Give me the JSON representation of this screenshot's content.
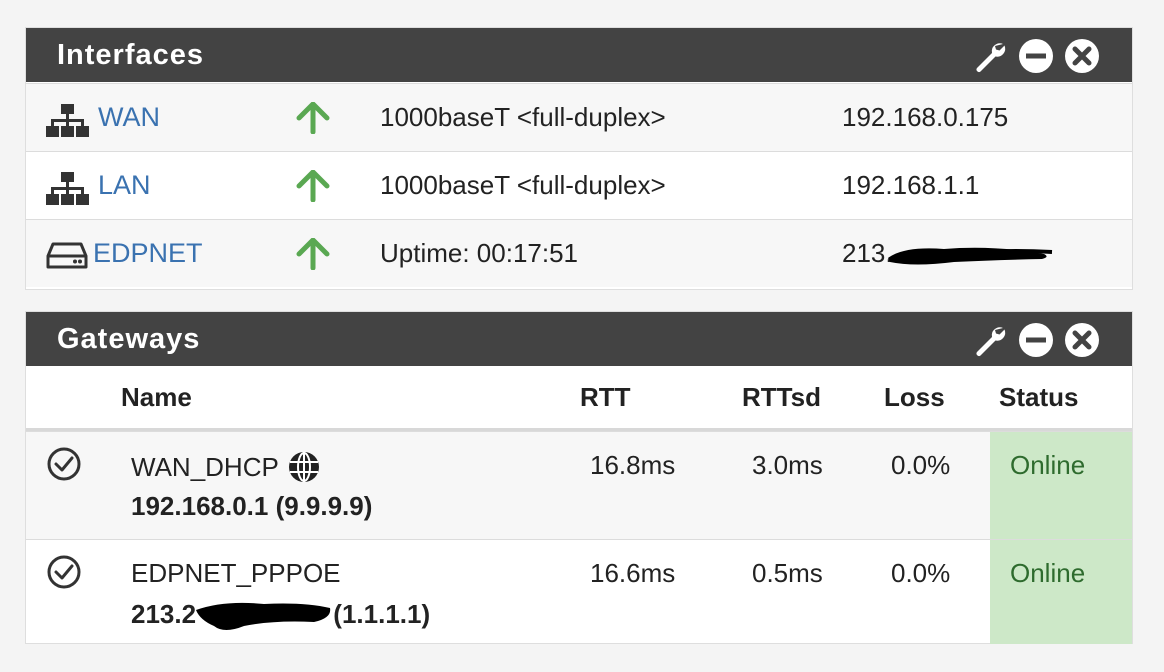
{
  "interfaces": {
    "title": "Interfaces",
    "rows": [
      {
        "name": "WAN",
        "icon": "network-icon",
        "status": "up",
        "media": "1000baseT <full-duplex>",
        "ip": "192.168.0.175"
      },
      {
        "name": "LAN",
        "icon": "network-icon",
        "status": "up",
        "media": "1000baseT <full-duplex>",
        "ip": "192.168.1.1"
      },
      {
        "name": "EDPNET",
        "icon": "modem-icon",
        "status": "up",
        "media": "Uptime: 00:17:51",
        "ip": "213."
      }
    ]
  },
  "gateways": {
    "title": "Gateways",
    "columns": {
      "name": "Name",
      "rtt": "RTT",
      "rttsd": "RTTsd",
      "loss": "Loss",
      "status": "Status"
    },
    "rows": [
      {
        "name": "WAN_DHCP",
        "default_icon": "globe-icon",
        "address": "192.168.0.1 (9.9.9.9)",
        "rtt": "16.8ms",
        "rttsd": "3.0ms",
        "loss": "0.0%",
        "status": "Online"
      },
      {
        "name": "EDPNET_PPPOE",
        "address_prefix": "213.2",
        "address_suffix": " (1.1.1.1)",
        "rtt": "16.6ms",
        "rttsd": "0.5ms",
        "loss": "0.0%",
        "status": "Online"
      }
    ]
  },
  "colors": {
    "header_bg": "#434343",
    "link": "#3a72b0",
    "status_up": "#5aa852",
    "online_bg": "#cde8c8",
    "online_text": "#2e6b2e"
  }
}
